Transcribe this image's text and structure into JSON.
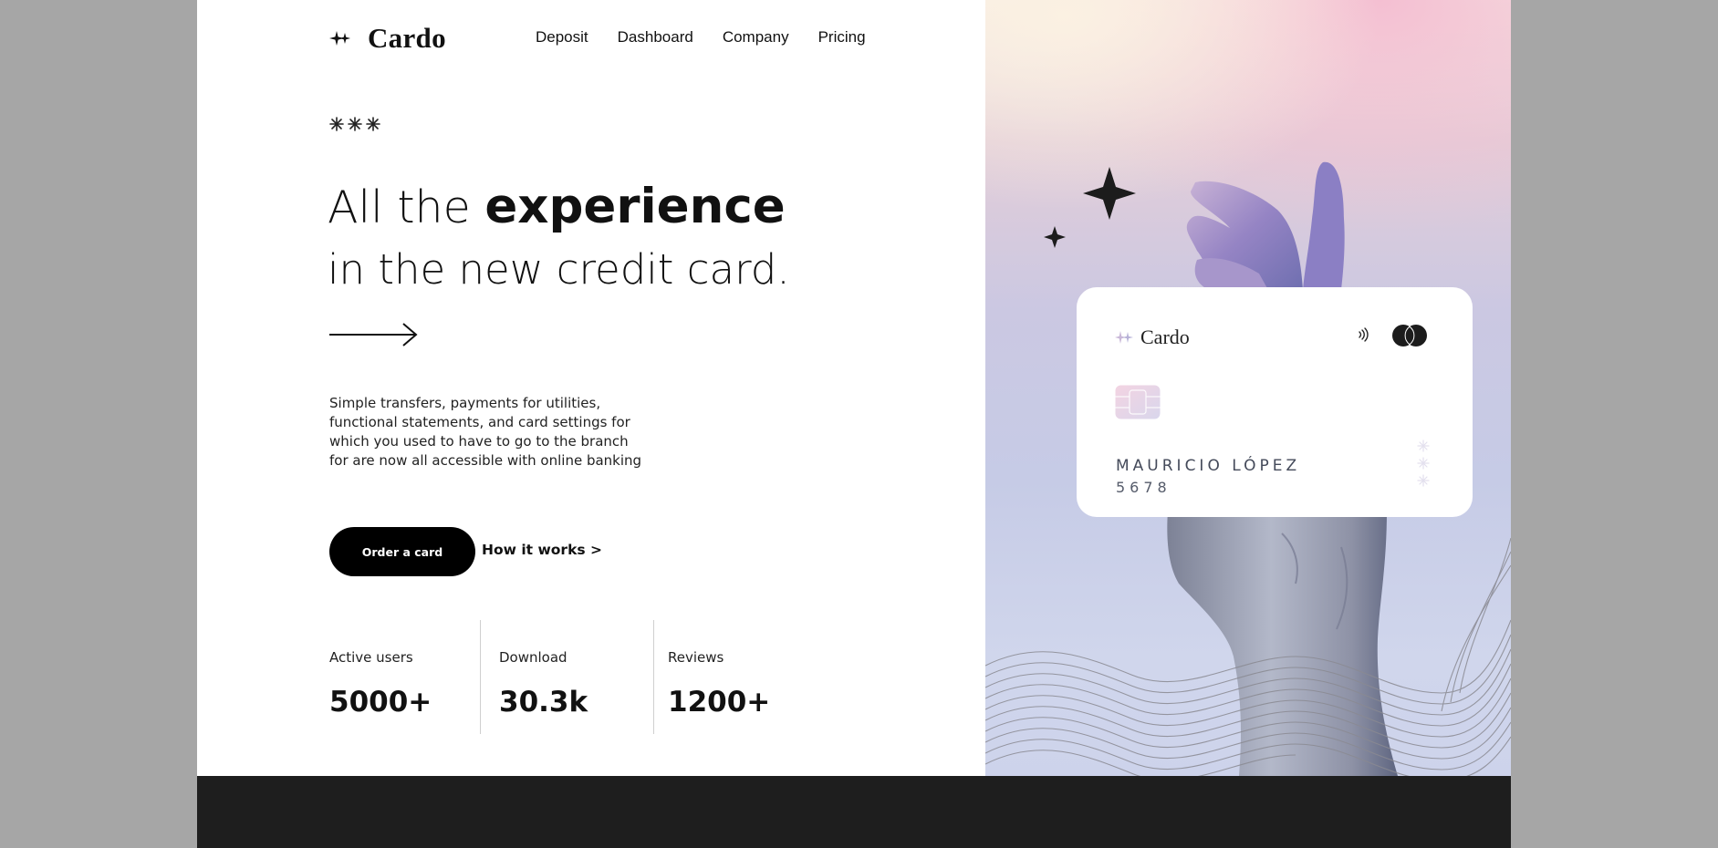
{
  "brand": {
    "name": "Cardo",
    "icon": "sparkle-icon"
  },
  "nav": {
    "items": [
      "Deposit",
      "Dashboard",
      "Company",
      "Pricing"
    ]
  },
  "hero": {
    "decoration": "asterisk-icons",
    "headline_light": "All the ",
    "headline_bold": "experience",
    "headline_line2": "in the new credit card.",
    "arrow_icon": "arrow-right-icon",
    "description": "Simple transfers, payments for utilities, functional statements, and card settings for which you used to have to go to the branch for are now all accessible with online banking",
    "primary_button": "Order a card",
    "secondary_link": "How it works >"
  },
  "stats": [
    {
      "label": "Active users",
      "value": "5000+"
    },
    {
      "label": "Download",
      "value": "30.3k"
    },
    {
      "label": "Reviews",
      "value": "1200+"
    }
  ],
  "card": {
    "brand": "Cardo",
    "holder": "MAURICIO LÓPEZ",
    "number": "5678",
    "icons": [
      "contactless-icon",
      "mastercard-icon",
      "chip-icon"
    ]
  },
  "colors": {
    "accent": "#000000",
    "footer": "#1e1e1e",
    "page_bg": "#a6a6a6"
  }
}
